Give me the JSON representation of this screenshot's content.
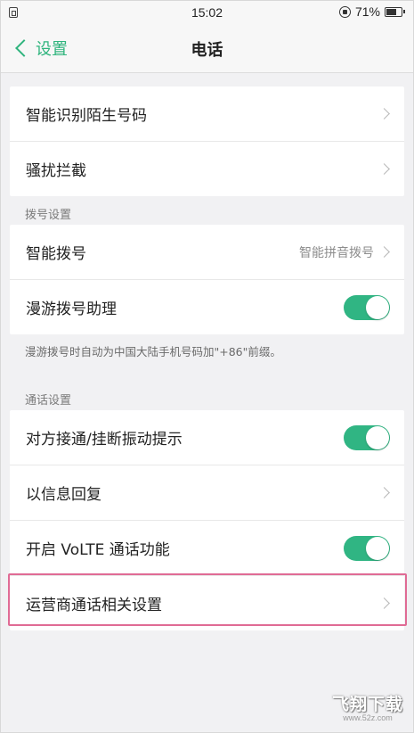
{
  "status_bar": {
    "time": "15:02",
    "battery_percent": "71%",
    "battery_level": 0.71
  },
  "nav": {
    "back_label": "设置",
    "title": "电话"
  },
  "group1": {
    "items": [
      {
        "label": "智能识别陌生号码"
      },
      {
        "label": "骚扰拦截"
      }
    ]
  },
  "dial_section": {
    "header": "拨号设置",
    "smart_dial": {
      "label": "智能拨号",
      "value": "智能拼音拨号"
    },
    "roaming": {
      "label": "漫游拨号助理",
      "enabled": true
    },
    "note": "漫游拨号时自动为中国大陆手机号码加\"+86\"前缀。"
  },
  "call_section": {
    "header": "通话设置",
    "vibrate": {
      "label": "对方接通/挂断振动提示",
      "enabled": true
    },
    "reply_message": {
      "label": "以信息回复"
    },
    "volte": {
      "label": "开启 VoLTE 通话功能",
      "enabled": true
    },
    "carrier": {
      "label": "运营商通话相关设置"
    }
  },
  "watermark": {
    "main": "飞翔下载",
    "sub": "www.52z.com"
  },
  "colors": {
    "accent": "#2fb47d",
    "toggle_on": "#30b583",
    "highlight": "#e06b95"
  }
}
